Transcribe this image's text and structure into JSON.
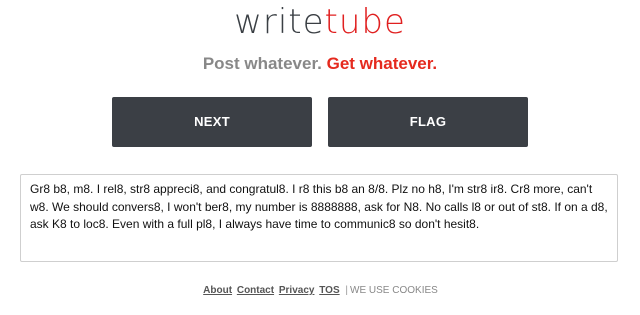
{
  "logo": {
    "part1": "write",
    "part2": "tube"
  },
  "tagline": {
    "part1": "Post whatever.",
    "part2": "Get whatever."
  },
  "buttons": {
    "next_label": "NEXT",
    "flag_label": "FLAG"
  },
  "post": {
    "text": "Gr8 b8, m8. I rel8, str8 appreci8, and congratul8. I r8 this b8 an 8/8. Plz no h8, I'm str8 ir8. Cr8 more, can't w8. We should convers8, I won't ber8, my number is 8888888, ask for N8. No calls l8 or out of st8. If on a d8, ask K8 to loc8. Even with a full pl8, I always have time to communic8 so don't hesit8."
  },
  "footer": {
    "links": [
      "About",
      "Contact",
      "Privacy",
      "TOS"
    ],
    "separator": "|",
    "notice": "WE USE COOKIES"
  },
  "colors": {
    "logo_dark": "#3a3f44",
    "accent_red": "#e02020",
    "tagline_gray": "#888888",
    "button_bg": "#3b3f45",
    "button_text": "#ffffff",
    "border": "#cfcfcf"
  }
}
